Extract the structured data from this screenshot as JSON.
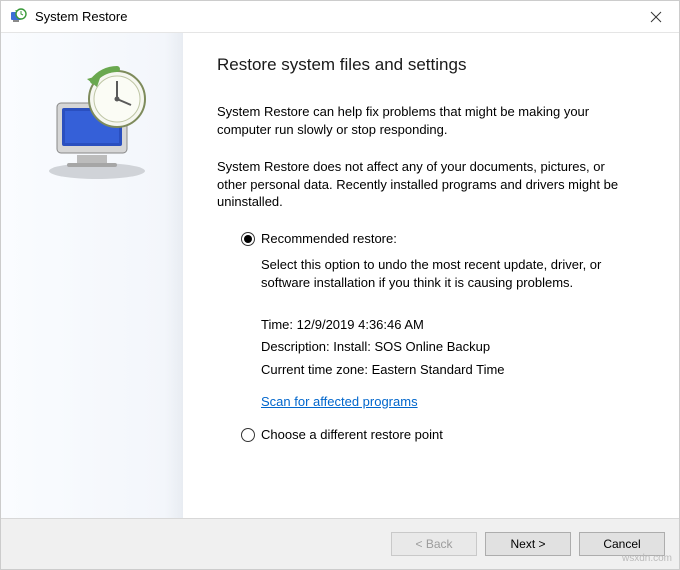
{
  "window": {
    "title": "System Restore"
  },
  "main": {
    "heading": "Restore system files and settings",
    "para1": "System Restore can help fix problems that might be making your computer run slowly or stop responding.",
    "para2": "System Restore does not affect any of your documents, pictures, or other personal data. Recently installed programs and drivers might be uninstalled.",
    "recommended": {
      "label": "Recommended restore:",
      "desc": "Select this option to undo the most recent update, driver, or software installation if you think it is causing problems.",
      "time_label": "Time:",
      "time_value": "12/9/2019 4:36:46 AM",
      "description_label": "Description:",
      "description_value": "Install: SOS Online Backup",
      "tz_label": "Current time zone:",
      "tz_value": "Eastern Standard Time"
    },
    "scan_link": "Scan for affected programs",
    "choose_different": {
      "label": "Choose a different restore point"
    }
  },
  "footer": {
    "back": "< Back",
    "next": "Next >",
    "cancel": "Cancel"
  },
  "watermark": "wsxdn.com"
}
